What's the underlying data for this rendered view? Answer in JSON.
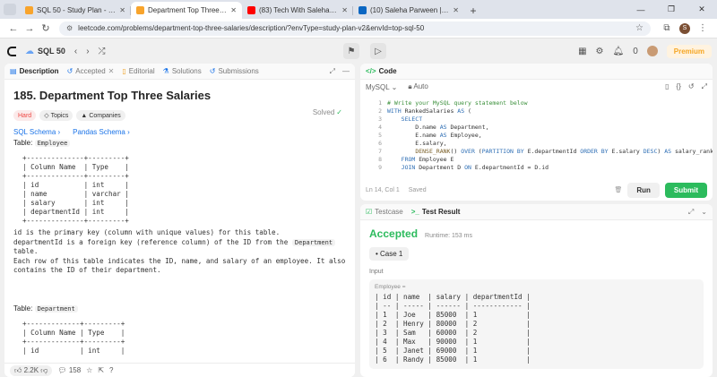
{
  "browser": {
    "tabs": [
      {
        "title": "SQL 50 - Study Plan - LeetCode",
        "favicon_color": "#f8a42c",
        "active": false
      },
      {
        "title": "Department Top Three Salaries",
        "favicon_color": "#f8a42c",
        "active": true
      },
      {
        "title": "(83) Tech With Saleha - YouTube",
        "favicon_color": "#ff0000",
        "active": false
      },
      {
        "title": "(10) Saleha Parween | LinkedIn",
        "favicon_color": "#0a66c2",
        "active": false
      }
    ],
    "new_tab": "+",
    "url": "leetcode.com/problems/department-top-three-salaries/description/?envType=study-plan-v2&envId=top-sql-50"
  },
  "lc_nav": {
    "study_plan": "SQL 50",
    "coins": "0",
    "premium": "Premium"
  },
  "left_tabs": [
    {
      "label": "Description",
      "icon": "doc-icon",
      "active": true
    },
    {
      "label": "Accepted",
      "icon": "history-icon",
      "active": false,
      "closable": true
    },
    {
      "label": "Editorial",
      "icon": "book-icon",
      "active": false
    },
    {
      "label": "Solutions",
      "icon": "flask-icon",
      "active": false
    },
    {
      "label": "Submissions",
      "icon": "history-icon",
      "active": false
    }
  ],
  "problem": {
    "title": "185. Department Top Three Salaries",
    "status": "Solved",
    "difficulty": "Hard",
    "topics": "Topics",
    "companies": "Companies",
    "sql_schema": "SQL Schema",
    "pandas_schema": "Pandas Schema",
    "table1_label": "Table: ",
    "table1_name": "Employee",
    "table1_ascii": "+--------------+---------+\n| Column Name  | Type    |\n+--------------+---------+\n| id           | int     |\n| name         | varchar |\n| salary       | int     |\n| departmentId | int     |\n+--------------+---------+",
    "para1": "id is the primary key (column with unique values) for this table.",
    "para2a": "departmentId is a foreign key (reference column) of the ID from the ",
    "para2_code": "Department",
    "para2b": "table.",
    "para3": "Each row of this table indicates the ID, name, and salary of an employee. It also contains the ID of their department.",
    "table2_label": "Table: ",
    "table2_name": "Department",
    "table2_ascii": "+-------------+---------+\n| Column Name | Type    |\n+-------------+---------+\n| id          | int     |"
  },
  "footer": {
    "likes": "2.2K",
    "comments": "158"
  },
  "code_panel": {
    "title": "Code",
    "language": "MySQL",
    "auto": "Auto",
    "status": "Ln 14, Col 1",
    "saved": "Saved",
    "run": "Run",
    "submit": "Submit"
  },
  "code_lines": [
    "1",
    "2",
    "3",
    "4",
    "5",
    "6",
    "7",
    "8",
    "9"
  ],
  "result": {
    "testcase_tab": "Testcase",
    "result_tab": "Test Result",
    "verdict": "Accepted",
    "runtime": "Runtime: 153 ms",
    "case": "Case 1",
    "input_label": "Input",
    "table_label": "Employee =",
    "table_text": "| id | name  | salary | departmentId |\n| -- | ----- | ------ | ------------ |\n| 1  | Joe   | 85000  | 1            |\n| 2  | Henry | 80000  | 2            |\n| 3  | Sam   | 60000  | 2            |\n| 4  | Max   | 90000  | 1            |\n| 5  | Janet | 69000  | 1            |\n| 6  | Randy | 85000  | 1            |"
  }
}
